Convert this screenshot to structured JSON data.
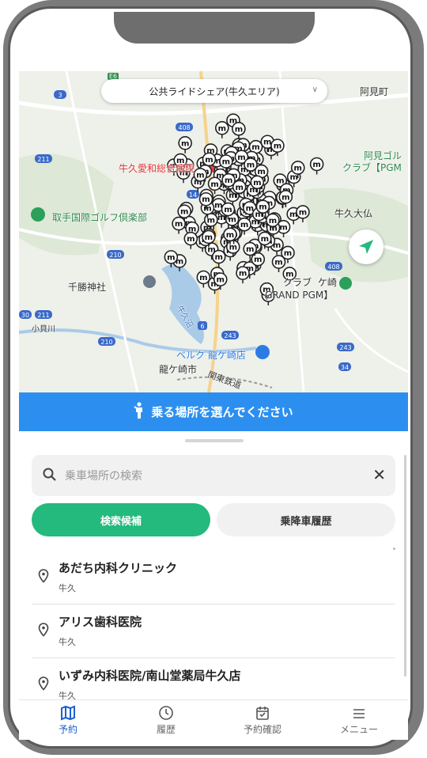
{
  "map": {
    "service_selector": "公共ライドシェア(牛久エリア)",
    "place_labels": {
      "hospital": "牛久愛和総合病院",
      "golf1": "取手国際ゴルフ倶楽部",
      "golf2a": "阿見ゴル",
      "golf2b": "クラブ【PGM",
      "ushiku_oohotoke": "牛久大仏",
      "ami_town": "阿見町",
      "chikatsu_shrine": "千勝神社",
      "golf3a": "クラブ",
      "golf3b": "ケ崎",
      "golf3c": "GRAND PGM】",
      "beruku": "ベルク 龍ケ崎店",
      "ryugasaki_city": "龍ケ崎市",
      "kanto_rail": "関東鉄道",
      "kokura_river": "小貝川",
      "ushiku_swamp": "牛久沼"
    },
    "route_numbers": [
      "3",
      "408",
      "211",
      "14",
      "210",
      "243",
      "6",
      "34",
      "30",
      "E6"
    ]
  },
  "banner": {
    "text": "乗る場所を選んでください"
  },
  "search": {
    "placeholder": "乗車場所の検索"
  },
  "tabs": {
    "candidates": "検索候補",
    "history": "乗降車履歴"
  },
  "results": [
    {
      "name": "あだち内科クリニック",
      "area": "牛久"
    },
    {
      "name": "アリス歯科医院",
      "area": "牛久"
    },
    {
      "name": "いずみ内科医院/南山堂薬局牛久店",
      "area": "牛久"
    }
  ],
  "nav": {
    "reserve": "予約",
    "history": "履歴",
    "confirm": "予約確認",
    "menu": "メニュー"
  },
  "colors": {
    "accent_blue": "#2c8ff0",
    "accent_green": "#24b97d",
    "nav_active": "#1a5fd0"
  }
}
